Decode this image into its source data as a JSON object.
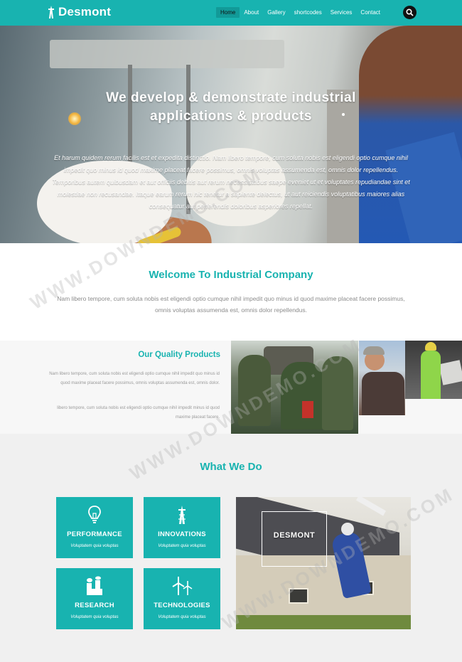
{
  "header": {
    "logo_text": "Desmont",
    "nav": [
      "Home",
      "About",
      "Gallery",
      "shortcodes",
      "Services",
      "Contact"
    ],
    "active_nav": "Home",
    "brand_color": "#18b3b0"
  },
  "hero": {
    "title_line1": "We develop & demonstrate industrial",
    "title_line2": "applications & products",
    "text": "Et harum quidem rerum facilis est et expedita distinctio. Nam libero tempore, cum soluta nobis est eligendi optio cumque nihil impedit quo minus id quod maxime placeat facere possimus, omnis voluptas assumenda est, omnis dolor repellendus. Temporibus autem quibusdam et aut officiis debitis aut rerum necessitatibus saepe eveniet ut et voluptates repudiandae sint et molestiae non recusandae. Itaque earum rerum hic tenetur a sapiente delectus, ut aut reiciendis voluptatibus maiores alias consequatur aut perferendis doloribus asperiores repellat."
  },
  "welcome": {
    "title": "Welcome To Industrial Company",
    "text": "Nam libero tempore, cum soluta nobis est eligendi optio cumque nihil impedit quo minus id quod maxime placeat facere possimus, omnis voluptas assumenda est, omnis dolor repellendus."
  },
  "quality": {
    "title": "Our Quality Products",
    "para1": "Nam libero tempore, cum soluta nobis est eligendi optio cumque nihil impedit quo minus id quod maxime placeat facere possimus, omnis voluptas assumenda est, omnis dolor.",
    "para2": "libero tempore, cum soluta nobis est eligendi optio cumque nihil impedit minus id quod maxime placeat facere."
  },
  "whatwedo": {
    "title": "What We Do",
    "cards": [
      {
        "title": "PERFORMANCE",
        "sub": "Voluptatem quia voluptas",
        "icon": "lightbulb-icon"
      },
      {
        "title": "INNOVATIONS",
        "sub": "Voluptatem quia voluptas",
        "icon": "tower-icon"
      },
      {
        "title": "RESEARCH",
        "sub": "Voluptatem quia voluptas",
        "icon": "factory-icon"
      },
      {
        "title": "TECHNOLOGIES",
        "sub": "Voluptatem quia voluptas",
        "icon": "wind-turbine-icon"
      }
    ],
    "feature_label": "DESMONT"
  },
  "watermark": "WWW.DOWNDEMO.COM"
}
